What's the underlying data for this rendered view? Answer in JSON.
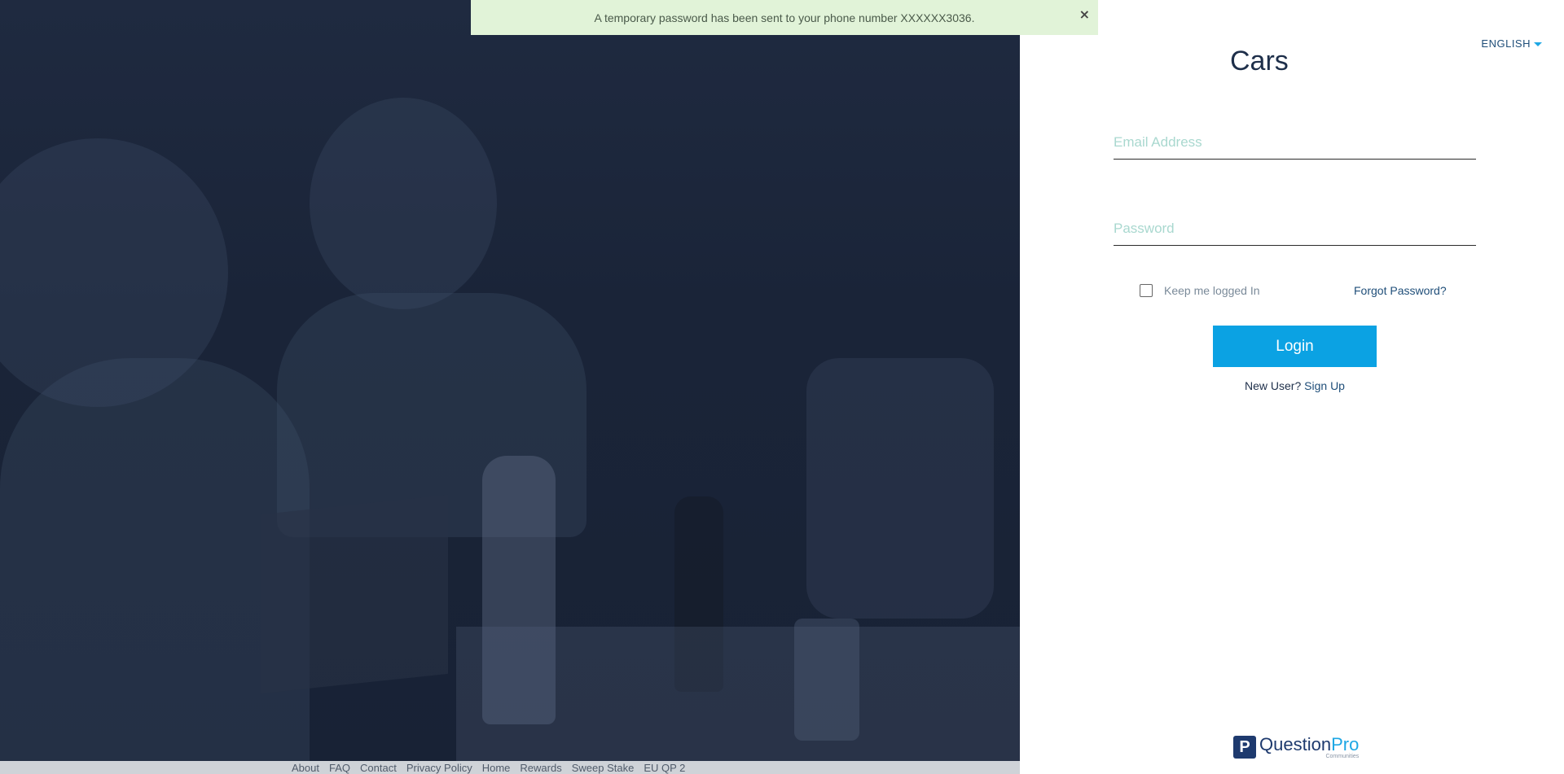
{
  "toast": {
    "message": "A temporary password has been sent to your phone number XXXXXX3036.",
    "close_icon": "×"
  },
  "language": {
    "selected": "ENGLISH"
  },
  "login": {
    "title": "Cars",
    "email_placeholder": "Email Address",
    "password_placeholder": "Password",
    "keep_logged_in": "Keep me logged In",
    "forgot_password": "Forgot Password?",
    "login_button": "Login",
    "new_user_prefix": "New User? ",
    "sign_up": "Sign Up"
  },
  "footer": {
    "links": [
      "About",
      "FAQ",
      "Contact",
      "Privacy Policy",
      "Home",
      "Rewards",
      "Sweep Stake",
      "EU QP 2"
    ]
  },
  "brand": {
    "logo_name_primary": "Question",
    "logo_name_secondary": "Pro",
    "logo_sub": "Communities",
    "logo_mark": "P"
  },
  "colors": {
    "accent": "#0ba2e3",
    "navy": "#1e2f4a",
    "toast_bg": "#e1f3d8",
    "photo_overlay": "#1f2a40"
  },
  "icons": {
    "close": "close-icon",
    "language_caret": "chevron-down-icon"
  }
}
